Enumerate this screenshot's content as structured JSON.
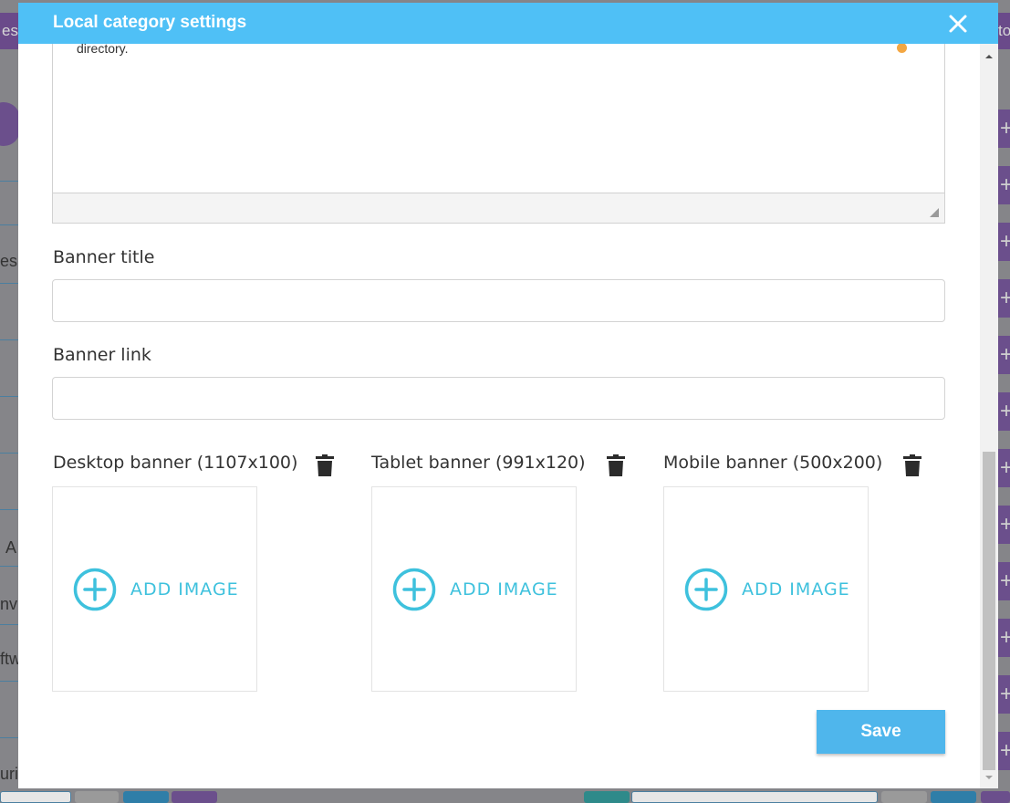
{
  "modal": {
    "title": "Local category settings"
  },
  "editor": {
    "visible_text": "directory."
  },
  "form": {
    "banner_title_label": "Banner title",
    "banner_title_value": "",
    "banner_link_label": "Banner link",
    "banner_link_value": ""
  },
  "banners": [
    {
      "label": "Desktop banner (1107x100)",
      "add_label": "ADD IMAGE"
    },
    {
      "label": "Tablet banner (991x120)",
      "add_label": "ADD IMAGE"
    },
    {
      "label": "Mobile banner (500x200)",
      "add_label": "ADD IMAGE"
    }
  ],
  "actions": {
    "save_label": "Save"
  },
  "background": {
    "left_fragments": [
      "es",
      "es",
      "A",
      "nvi",
      "ftw",
      "uri"
    ],
    "right_fragment": "to"
  },
  "colors": {
    "header": "#4fc0f6",
    "accent": "#3ec1dd",
    "save": "#4fb6ec",
    "purple": "#6b4f8c"
  },
  "icons": {
    "close": "close-icon",
    "trash": "trash-icon",
    "add": "plus-circle-icon"
  }
}
